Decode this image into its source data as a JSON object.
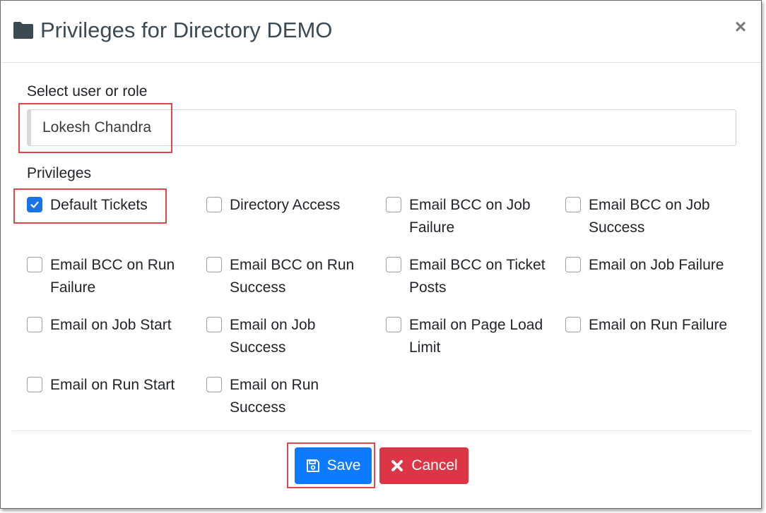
{
  "dialog": {
    "title": "Privileges for Directory DEMO",
    "close_glyph": "×",
    "icon": "folder-icon"
  },
  "user_select": {
    "label": "Select user or role",
    "value": "Lokesh Chandra"
  },
  "privileges": {
    "label": "Privileges",
    "items": [
      {
        "label": "Default Tickets",
        "checked": true
      },
      {
        "label": "Directory Access",
        "checked": false
      },
      {
        "label": "Email BCC on Job Failure",
        "checked": false
      },
      {
        "label": "Email BCC on Job Success",
        "checked": false
      },
      {
        "label": "Email BCC on Run Failure",
        "checked": false
      },
      {
        "label": "Email BCC on Run Success",
        "checked": false
      },
      {
        "label": "Email BCC on Ticket Posts",
        "checked": false
      },
      {
        "label": "Email on Job Failure",
        "checked": false
      },
      {
        "label": "Email on Job Start",
        "checked": false
      },
      {
        "label": "Email on Job Success",
        "checked": false
      },
      {
        "label": "Email on Page Load Limit",
        "checked": false
      },
      {
        "label": "Email on Run Failure",
        "checked": false
      },
      {
        "label": "Email on Run Start",
        "checked": false
      },
      {
        "label": "Email on Run Success",
        "checked": false
      }
    ]
  },
  "footer": {
    "save_label": "Save",
    "cancel_label": "Cancel"
  },
  "colors": {
    "primary": "#0d7bff",
    "danger": "#dc3545",
    "highlight": "#e0494c",
    "checkbox_checked": "#1a73e8"
  }
}
